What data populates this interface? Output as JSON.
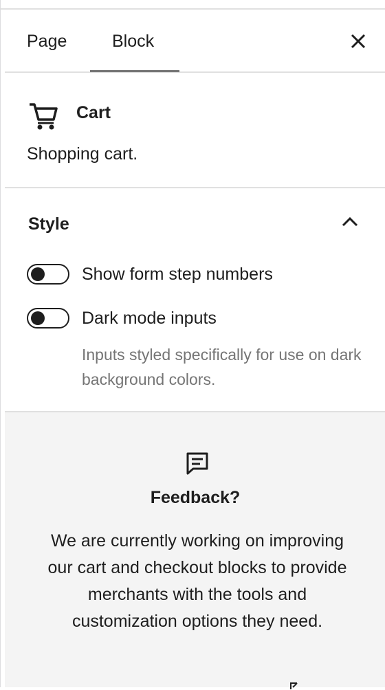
{
  "tabs": [
    {
      "label": "Page",
      "active": false
    },
    {
      "label": "Block",
      "active": true
    }
  ],
  "icons": {
    "close": "close-icon",
    "cart": "cart-icon",
    "chevron": "chevron-up-icon",
    "feedback": "comment-icon",
    "external": "external-link-icon"
  },
  "block": {
    "title": "Cart",
    "description": "Shopping cart."
  },
  "style": {
    "title": "Style",
    "toggles": [
      {
        "label": "Show form step numbers",
        "checked": false
      },
      {
        "label": "Dark mode inputs",
        "checked": false
      }
    ],
    "help": "Inputs styled specifically for use on dark background colors."
  },
  "feedback": {
    "title": "Feedback?",
    "body": "We are currently working on improving our cart and checkout blocks to provide merchants with the tools and customization options they need."
  },
  "colors": {
    "text": "#1e1e1e",
    "muted": "#757575",
    "border": "#e0e0e0",
    "feedback_bg": "#f4f4f4"
  }
}
